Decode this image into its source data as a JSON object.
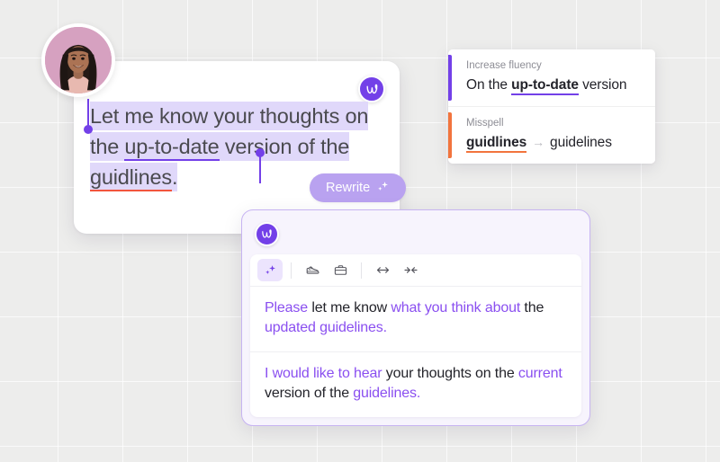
{
  "background": {
    "color": "#ededec",
    "grid_line_color": "#ffffff",
    "grid_size_px": 72
  },
  "avatar": {
    "name": "user-avatar",
    "bg_color": "#d9a3c2",
    "ring_color": "#ffffff"
  },
  "editor": {
    "logo_glyph": "w",
    "logo_color": "#7340e8",
    "selection_color": "#e0d8fa",
    "text_segments": [
      {
        "text": "Let me know your thoughts on the ",
        "style": "selected"
      },
      {
        "text": "up-to-date",
        "style": "selected fluency-underline"
      },
      {
        "text": " version of the ",
        "style": "selected"
      },
      {
        "text": "guidlines",
        "style": "selected misspell-underline"
      },
      {
        "text": ".",
        "style": "selected"
      }
    ],
    "full_text": "Let me know your thoughts on the up-to-date version of the guidlines.",
    "fluency_underline_color": "#7340e8",
    "misspell_underline_color": "#f2553d",
    "rewrite_button": {
      "label": "Rewrite",
      "icon": "sparkle-icon",
      "bg_color": "#b9a2f0",
      "text_color": "#ffffff"
    }
  },
  "suggestions": [
    {
      "category": "Increase fluency",
      "accent_color": "#7340e8",
      "type": "fluency",
      "before_text": "On the ",
      "highlight": "up-to-date",
      "after_text": " version"
    },
    {
      "category": "Misspell",
      "accent_color": "#f2743d",
      "type": "misspell",
      "wrong_word": "guidlines",
      "arrow": "→",
      "correct_word": "guidelines"
    }
  ],
  "rewrite_panel": {
    "logo_glyph": "w",
    "border_color": "#c7b4f2",
    "bg_color": "#f7f4fd",
    "toolbar": [
      {
        "name": "sparkle-icon",
        "label": "Improve",
        "active": true
      },
      {
        "name": "sneaker-icon",
        "label": "Casual",
        "active": false
      },
      {
        "name": "briefcase-icon",
        "label": "Formal",
        "active": false
      },
      {
        "name": "expand-arrows-icon",
        "label": "Expand",
        "active": false
      },
      {
        "name": "shrink-arrows-icon",
        "label": "Shorten",
        "active": false
      }
    ],
    "options": [
      {
        "segments": [
          {
            "text": "Please",
            "highlight": true
          },
          {
            "text": " let me know ",
            "highlight": false
          },
          {
            "text": "what you think about",
            "highlight": true
          },
          {
            "text": " the ",
            "highlight": false
          },
          {
            "text": "updated guidelines",
            "highlight": true
          },
          {
            "text": ".",
            "highlight": false
          }
        ],
        "plain": "Please let me know what you think about the updated guidelines."
      },
      {
        "segments": [
          {
            "text": "I would like to hear",
            "highlight": true
          },
          {
            "text": " your thoughts on the ",
            "highlight": false
          },
          {
            "text": "current",
            "highlight": true
          },
          {
            "text": " version of the ",
            "highlight": false
          },
          {
            "text": "guidelines",
            "highlight": true
          },
          {
            "text": ".",
            "highlight": false
          }
        ],
        "plain": "I would like to hear your thoughts on the current version of the guidelines."
      }
    ],
    "highlight_color": "#8a4ff0"
  }
}
